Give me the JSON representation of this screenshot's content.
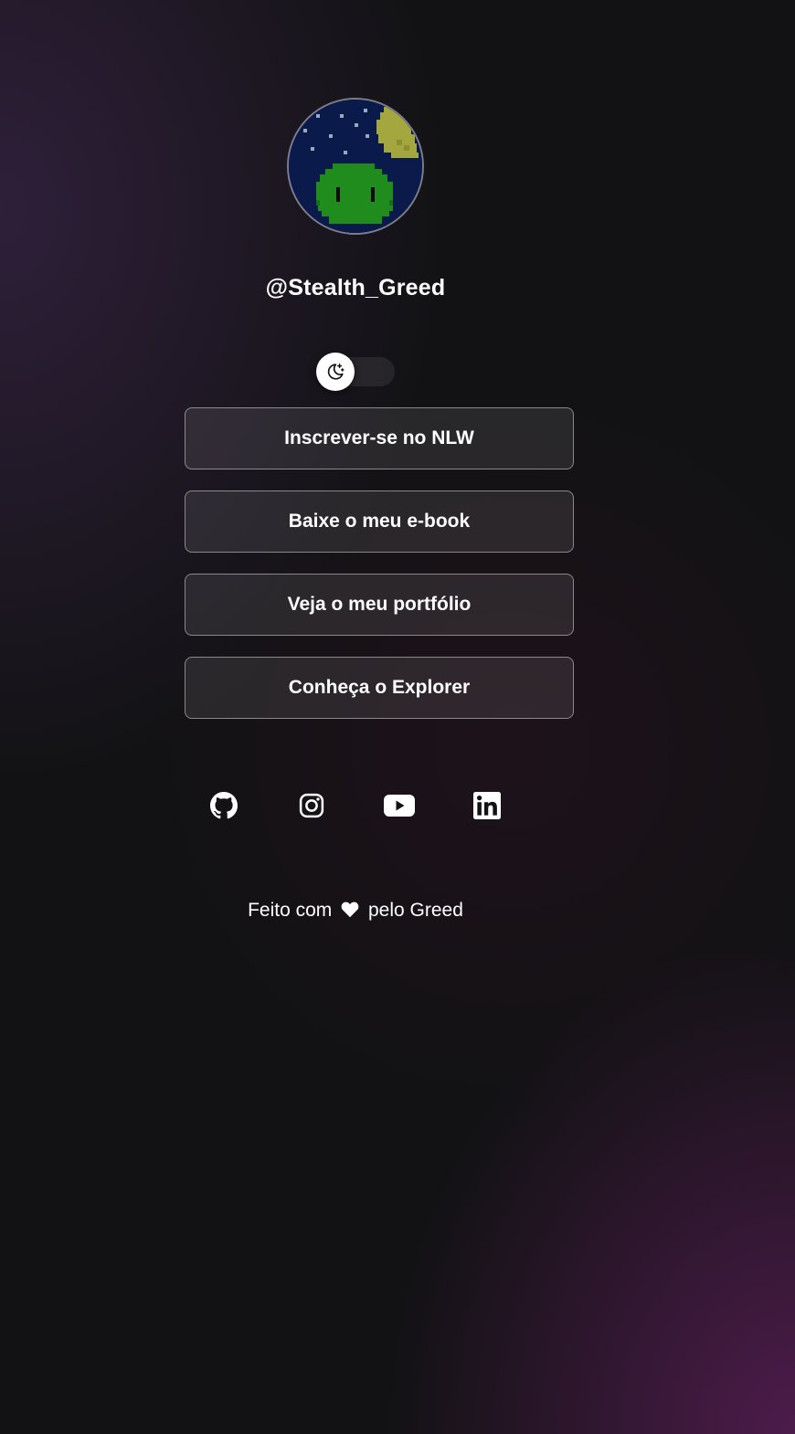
{
  "profile": {
    "username": "@Stealth_Greed",
    "avatar": "pixel-art green slime under starry night sky with yellow moon"
  },
  "theme_switch": {
    "icon": "moon-stars-icon",
    "state": "dark"
  },
  "links": [
    {
      "label": "Inscrever-se no NLW"
    },
    {
      "label": "Baixe o meu e-book"
    },
    {
      "label": "Veja o meu portfólio"
    },
    {
      "label": "Conheça o Explorer"
    }
  ],
  "social": [
    {
      "icon": "github-icon"
    },
    {
      "icon": "instagram-icon"
    },
    {
      "icon": "youtube-icon"
    },
    {
      "icon": "linkedin-icon"
    }
  ],
  "footer": {
    "prefix": "Feito com",
    "heart_icon": "heart-icon",
    "suffix": "pelo Greed"
  },
  "colors": {
    "background": "#121214",
    "button_border": "#7c7c8a",
    "text": "#ffffff"
  }
}
